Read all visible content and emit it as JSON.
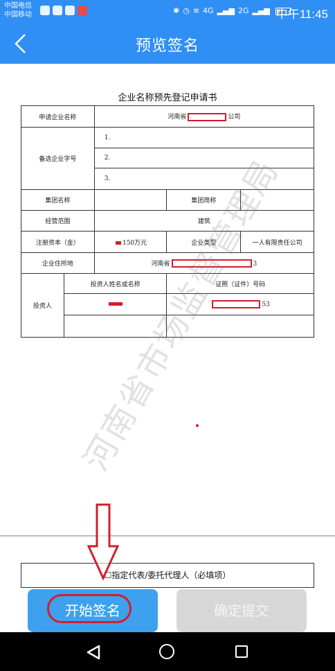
{
  "status_bar": {
    "carrier1": "中国电信",
    "carrier2": "中国移动",
    "network1": "4G",
    "network2": "2G",
    "time": "中午11:45"
  },
  "app_bar": {
    "title": "预览签名"
  },
  "document": {
    "title": "企业名称预先登记申请书",
    "labels": {
      "company_name": "申请企业名称",
      "alt_names": "备选企业字号",
      "group_name": "集团名称",
      "group_short": "集团简称",
      "scope": "经营范围",
      "capital": "注册资本（金）",
      "company_type": "企业类型",
      "address": "企业住所地",
      "investors": "投资人",
      "investor_name_header": "投资人姓名或名称",
      "cert_header": "证照（证件）号码"
    },
    "values": {
      "company_name_prefix": "河南省",
      "company_name_suffix": "公司",
      "alt_1": "1.",
      "alt_2": "2.",
      "alt_3": "3.",
      "scope": "建筑",
      "capital": "150万元",
      "company_type": "一人有限责任公司",
      "address_prefix": "河南省",
      "address_suffix": "3",
      "cert_suffix": "53"
    },
    "watermark": "河南省市场监督管理局",
    "agent_line": "☐指定代表/委托代理人（必填项）"
  },
  "buttons": {
    "start_sign": "开始签名",
    "confirm_submit": "确定提交"
  }
}
